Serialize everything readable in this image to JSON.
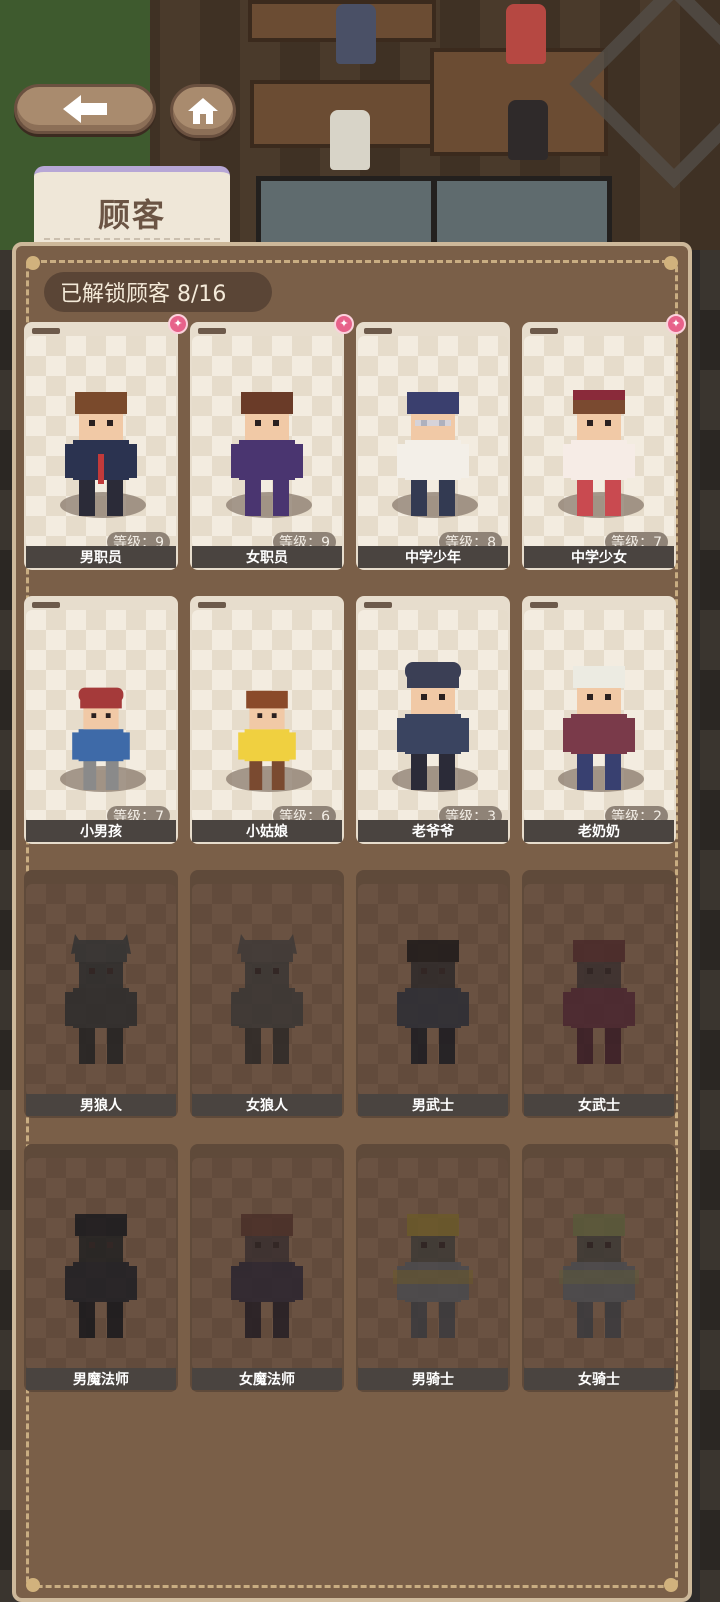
{
  "header": {
    "back_icon": "arrow-left-icon",
    "home_icon": "home-icon",
    "title": "顾客"
  },
  "panel": {
    "unlocked_text": "已解锁顾客 8/16",
    "unlocked_count": 8,
    "total_count": 16
  },
  "customers": [
    {
      "name": "男职员",
      "level": "等级：9",
      "unlocked": true,
      "new": true
    },
    {
      "name": "女职员",
      "level": "等级：9",
      "unlocked": true,
      "new": true
    },
    {
      "name": "中学少年",
      "level": "等级：8",
      "unlocked": true,
      "new": false
    },
    {
      "name": "中学少女",
      "level": "等级：7",
      "unlocked": true,
      "new": true
    },
    {
      "name": "小男孩",
      "level": "等级：7",
      "unlocked": true,
      "new": false
    },
    {
      "name": "小姑娘",
      "level": "等级：6",
      "unlocked": true,
      "new": false
    },
    {
      "name": "老爷爷",
      "level": "等级：3",
      "unlocked": true,
      "new": false
    },
    {
      "name": "老奶奶",
      "level": "等级：2",
      "unlocked": true,
      "new": false
    },
    {
      "name": "男狼人",
      "unlocked": false
    },
    {
      "name": "女狼人",
      "unlocked": false
    },
    {
      "name": "男武士",
      "unlocked": false
    },
    {
      "name": "女武士",
      "unlocked": false
    },
    {
      "name": "男魔法师",
      "unlocked": false
    },
    {
      "name": "女魔法师",
      "unlocked": false
    },
    {
      "name": "男骑士",
      "unlocked": false
    },
    {
      "name": "女骑士",
      "unlocked": false
    }
  ],
  "colors": {
    "panel": "#7a5f48",
    "card": "#e7ddcd",
    "locked_card": "#5f4a3a",
    "badge": "#e7628a",
    "name_bar": "#4a4440"
  }
}
